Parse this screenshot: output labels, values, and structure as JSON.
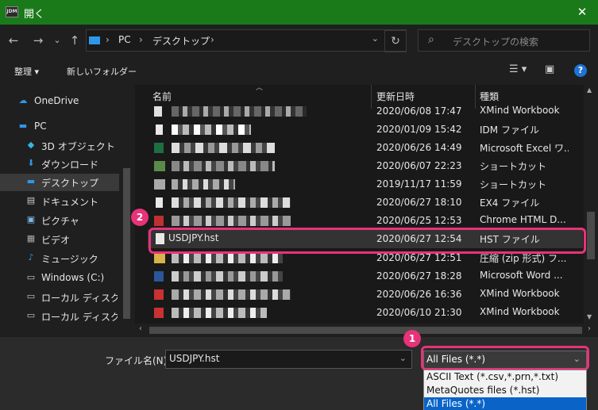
{
  "window": {
    "title": "開く",
    "app_icon_text": "JDM",
    "close_glyph": "✕"
  },
  "nav": {
    "back": "←",
    "forward": "→",
    "recent": "⌄",
    "up": "↑",
    "breadcrumb": [
      "PC",
      "デスクトップ"
    ],
    "refresh": "↻",
    "search_placeholder": "デスクトップの検索"
  },
  "toolbar": {
    "organize": "整理 ▾",
    "new_folder": "新しいフォルダー",
    "help": "?"
  },
  "sidebar": {
    "items": [
      {
        "label": "OneDrive",
        "icon": "cloud-icon",
        "glyph": "☁",
        "color": "#2e97e8"
      },
      {
        "label": "PC",
        "icon": "pc-icon",
        "glyph": "▬",
        "color": "#2e97e8"
      },
      {
        "label": "3D オブジェクト",
        "icon": "cube-icon",
        "glyph": "◆",
        "color": "#35b5e8"
      },
      {
        "label": "ダウンロード",
        "icon": "download-icon",
        "glyph": "⬇",
        "color": "#2e97e8"
      },
      {
        "label": "デスクトップ",
        "icon": "desktop-icon",
        "glyph": "▬",
        "color": "#2e97e8"
      },
      {
        "label": "ドキュメント",
        "icon": "document-icon",
        "glyph": "▤",
        "color": "#cccccc"
      },
      {
        "label": "ピクチャ",
        "icon": "picture-icon",
        "glyph": "▣",
        "color": "#7ab8e8"
      },
      {
        "label": "ビデオ",
        "icon": "video-icon",
        "glyph": "▦",
        "color": "#aaaaaa"
      },
      {
        "label": "ミュージック",
        "icon": "music-icon",
        "glyph": "♪",
        "color": "#2e97e8"
      },
      {
        "label": "Windows (C:)",
        "icon": "drive-icon",
        "glyph": "▭",
        "color": "#cccccc"
      },
      {
        "label": "ローカル ディスク (I:",
        "icon": "drive-icon",
        "glyph": "▭",
        "color": "#cccccc"
      },
      {
        "label": "ローカル ディスク (J:",
        "icon": "drive-icon",
        "glyph": "▭",
        "color": "#cccccc"
      }
    ]
  },
  "columns": {
    "name": "名前",
    "date": "更新日時",
    "type": "種類"
  },
  "files": [
    {
      "name": "",
      "date": "2020/06/08 17:47",
      "type": "XMind Workbook"
    },
    {
      "name": "",
      "date": "2020/01/09 15:42",
      "type": "IDM ファイル"
    },
    {
      "name": "",
      "date": "2020/06/26 14:49",
      "type": "Microsoft Excel ワ..."
    },
    {
      "name": "",
      "date": "2020/06/07 22:23",
      "type": "ショートカット"
    },
    {
      "name": "",
      "date": "2019/11/17 11:59",
      "type": "ショートカット"
    },
    {
      "name": "",
      "date": "2020/06/27 18:10",
      "type": "EX4 ファイル"
    },
    {
      "name": "",
      "date": "2020/06/25 12:53",
      "type": "Chrome HTML D..."
    },
    {
      "name": "USDJPY.hst",
      "date": "2020/06/27 12:54",
      "type": "HST ファイル"
    },
    {
      "name": "",
      "date": "2020/06/27 12:51",
      "type": "圧縮 (zip 形式) フ..."
    },
    {
      "name": "",
      "date": "2020/06/27 18:28",
      "type": "Microsoft Word ..."
    },
    {
      "name": "",
      "date": "2020/06/26 16:36",
      "type": "XMind Workbook"
    },
    {
      "name": "",
      "date": "2020/06/10 21:30",
      "type": "XMind Workbook"
    }
  ],
  "filename": {
    "label": "ファイル名(N):",
    "value": "USDJPY.hst"
  },
  "filetype": {
    "selected": "All Files (*.*)",
    "options": [
      "ASCII Text (*.csv,*.prn,*.txt)",
      "MetaQuotes files (*.hst)",
      "All Files (*.*)"
    ]
  },
  "annotations": {
    "badge1": "1",
    "badge2": "2"
  },
  "colors": {
    "title_bar": "#1a7a1a",
    "highlight": "#e8327a",
    "accent": "#0a64c8"
  }
}
